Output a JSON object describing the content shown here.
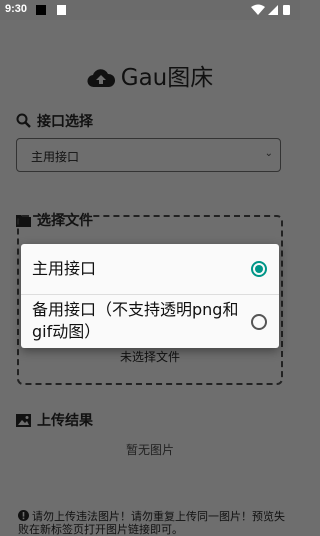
{
  "status_bar": {
    "time": "9:30",
    "icons": [
      "notification-square-icon",
      "notification-a-icon",
      "wifi-icon",
      "signal-icon",
      "battery-icon"
    ]
  },
  "app": {
    "title": "Gau图床",
    "icon": "cloud-upload-icon"
  },
  "interface_section": {
    "label": "接口选择",
    "icon": "search-icon",
    "selected": "主用接口"
  },
  "file_section": {
    "label": "选择文件",
    "icon": "folder-icon",
    "empty_text": "未选择文件"
  },
  "result_section": {
    "label": "上传结果",
    "icon": "image-icon",
    "empty_text": "暂无图片"
  },
  "notice": {
    "icon": "alert-icon",
    "text": "请勿上传违法图片！请勿重复上传同一图片！预览失败在新标签页打开图片链接即可。"
  },
  "dialog": {
    "options": [
      {
        "label": "主用接口",
        "selected": true
      },
      {
        "label": "备用接口（不支持透明png和gif动图）",
        "selected": false
      }
    ]
  },
  "colors": {
    "accent": "#009688",
    "scrim": "#6e6e6e",
    "dialog_bg": "#fafafa"
  }
}
